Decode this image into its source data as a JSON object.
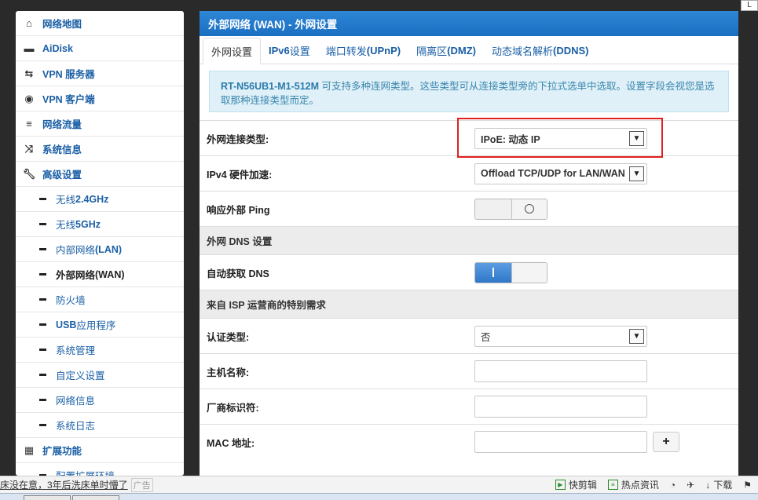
{
  "sidebar": {
    "items": [
      {
        "label": "网络地图",
        "icon": "home-icon"
      },
      {
        "label": "AiDisk",
        "icon": "disk-icon"
      },
      {
        "label": "VPN 服务器",
        "icon": "vpn-server-icon"
      },
      {
        "label": "VPN 客户端",
        "icon": "globe-icon"
      },
      {
        "label": "网络流量",
        "icon": "list-icon"
      },
      {
        "label": "系统信息",
        "icon": "shuffle-icon"
      },
      {
        "label": "高级设置",
        "icon": "wrench-icon"
      }
    ],
    "subitems": [
      {
        "prefix": "无线 ",
        "bold": "2.4GHz"
      },
      {
        "prefix": "无线 ",
        "bold": "5GHz"
      },
      {
        "prefix": "内部网络 ",
        "bold": "(LAN)"
      },
      {
        "prefix": "外部网络 ",
        "bold": "(WAN)"
      },
      {
        "prefix": "防火墙",
        "bold": ""
      },
      {
        "prefix": "",
        "bold": "USB",
        "suffix": " 应用程序"
      },
      {
        "prefix": "系统管理",
        "bold": ""
      },
      {
        "prefix": "自定义设置",
        "bold": ""
      },
      {
        "prefix": "网络信息",
        "bold": ""
      },
      {
        "prefix": "系统日志",
        "bold": ""
      }
    ],
    "extensions": {
      "label": "扩展功能",
      "icon": "grid-icon"
    },
    "cut_item": "配置扩展环境"
  },
  "header": {
    "title": "外部网络 (WAN) - 外网设置"
  },
  "tabs": [
    {
      "label": "外网设置"
    },
    {
      "label_bold": "IPv6",
      "label": " 设置"
    },
    {
      "label": "端口转发 ",
      "label_bold": "(UPnP)"
    },
    {
      "label": "隔离区 ",
      "label_bold": "(DMZ)"
    },
    {
      "label": "动态域名解析 ",
      "label_bold": "(DDNS)"
    }
  ],
  "alert": {
    "model": "RT-N56UB1-M1-512M",
    "text": " 可支持多种连网类型。这些类型可从连接类型旁的下拉式选单中选取。设置字段会视您是选取那种连接类型而定。"
  },
  "form": {
    "wan_type_label": "外网连接类型:",
    "wan_type_value": "IPoE: 动态 IP",
    "hw_accel_label": "IPv4 硬件加速:",
    "hw_accel_value": "Offload TCP/UDP for LAN/WAN",
    "ping_label": "响应外部 Ping",
    "ping_state": "off",
    "dns_section": "外网 DNS 设置",
    "auto_dns_label": "自动获取 DNS",
    "auto_dns_state": "on",
    "isp_section": "来自 ISP 运营商的特别需求",
    "auth_label": "认证类型:",
    "auth_value": "否",
    "hostname_label": "主机名称:",
    "hostname_value": "",
    "vendor_label": "厂商标识符:",
    "vendor_value": "",
    "mac_label": "MAC 地址:",
    "mac_value": "",
    "mac_add": "+"
  },
  "statusbar": {
    "left_text": "床没在意，3年后洗床单时懵了",
    "left_tag": "广告",
    "items": [
      "快剪辑",
      "热点资讯",
      "下载"
    ]
  },
  "corner": "L"
}
